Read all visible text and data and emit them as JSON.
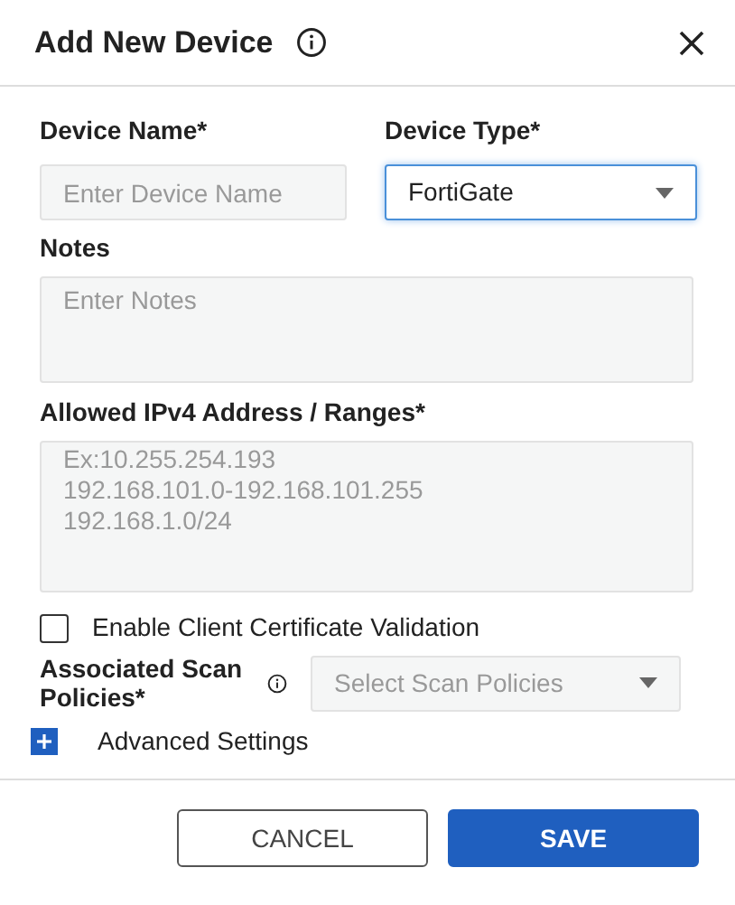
{
  "dialog": {
    "title": "Add New Device"
  },
  "device_name": {
    "label": "Device Name*",
    "placeholder": "Enter Device Name"
  },
  "device_type": {
    "label": "Device Type*",
    "value": "FortiGate",
    "focused": true
  },
  "notes": {
    "label": "Notes",
    "placeholder": "Enter Notes"
  },
  "allowed_ipv4": {
    "label": "Allowed IPv4 Address / Ranges*",
    "placeholder": "Ex:10.255.254.193\n192.168.101.0-192.168.101.255\n192.168.1.0/24"
  },
  "client_cert": {
    "label": "Enable Client Certificate Validation",
    "checked": false
  },
  "scan_policies": {
    "label": "Associated Scan Policies*",
    "placeholder": "Select Scan Policies"
  },
  "advanced_settings": {
    "label": "Advanced Settings",
    "expanded": false
  },
  "buttons": [
    {
      "kind": "secondary",
      "label": "CANCEL"
    },
    {
      "kind": "primary",
      "label": "SAVE"
    }
  ]
}
